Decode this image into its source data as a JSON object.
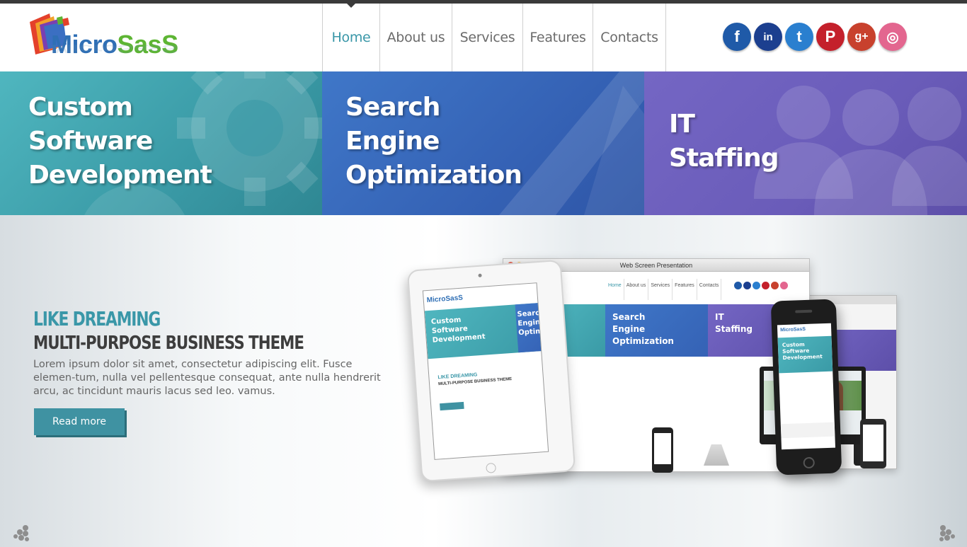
{
  "logo": {
    "text_micro": "Micro",
    "text_sass": "SasS"
  },
  "nav": [
    {
      "label": "Home",
      "active": true
    },
    {
      "label": "About us",
      "active": false
    },
    {
      "label": "Services",
      "active": false
    },
    {
      "label": "Features",
      "active": false
    },
    {
      "label": "Contacts",
      "active": false
    }
  ],
  "social": [
    {
      "icon": "facebook-icon",
      "glyph": "f",
      "color": "#1f5aa8"
    },
    {
      "icon": "linkedin-icon",
      "glyph": "in",
      "color": "#1c3f8f"
    },
    {
      "icon": "twitter-icon",
      "glyph": "t",
      "color": "#2a7fcf"
    },
    {
      "icon": "pinterest-icon",
      "glyph": "P",
      "color": "#c4202b"
    },
    {
      "icon": "google-plus-icon",
      "glyph": "g+",
      "color": "#c8412d"
    },
    {
      "icon": "dribbble-icon",
      "glyph": "◎",
      "color": "#e3668f"
    }
  ],
  "banner": {
    "panel1": "Custom\nSoftware\nDevelopment",
    "panel2": "Search\nEngine\nOptimization",
    "panel3": "IT\nStaffing"
  },
  "hero": {
    "eyebrow": "LIKE DREAMING",
    "headline": "MULTI-PURPOSE BUSINESS THEME",
    "body": "Lorem ipsum dolor sit amet, consectetur adipiscing elit. Fusce elemen-tum, nulla vel pellentesque consequat, ante nulla hendrerit arcu, ac tincidunt mauris lacus sed leo. vamus.",
    "button": "Read more"
  },
  "mockup": {
    "window_title": "Web Screen Presentation",
    "mini_nav": [
      "Home",
      "About us",
      "Services",
      "Features",
      "Contacts"
    ],
    "mini_panel2": "Search\nEngine\nOptimization",
    "mini_panel3": "IT\nStaffing",
    "tablet_logo": "MicroSasS",
    "tablet_panel": "Custom\nSoftware\nDevelopment",
    "tablet_panel2": "Searc\nEngin\nOptim",
    "tablet_eyebrow": "LIKE DREAMING",
    "tablet_headline": "MULTI-PURPOSE BUSINESS THEME",
    "phone_panel": "Custom\nSoftware\nDevelopment",
    "phone_logo": "MicroSasS"
  },
  "colors": {
    "accent": "#3a97a8",
    "panel1": "#3a9aa6",
    "panel2": "#3562b5",
    "panel3": "#6a5cb9"
  }
}
